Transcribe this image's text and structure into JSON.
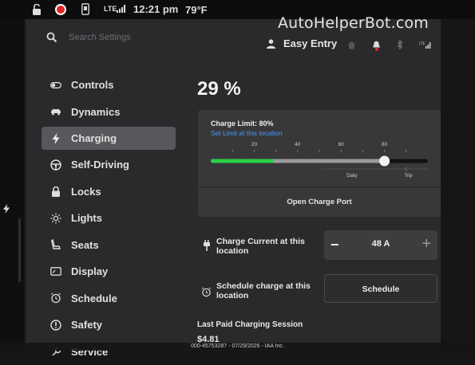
{
  "watermark": "AutoHelperBot.com",
  "status": {
    "lte": "LTE",
    "time": "12:21 pm",
    "temperature": "79°F"
  },
  "search": {
    "placeholder": "Search Settings"
  },
  "profile": {
    "name": "Easy Entry"
  },
  "top_icons": [
    "home-icon",
    "bell-icon",
    "bluetooth-icon",
    "lte-signal-icon"
  ],
  "sidebar": {
    "items": [
      {
        "label": "Controls",
        "icon": "toggle-icon",
        "active": false
      },
      {
        "label": "Dynamics",
        "icon": "car-icon",
        "active": false
      },
      {
        "label": "Charging",
        "icon": "lightning-icon",
        "active": true
      },
      {
        "label": "Self-Driving",
        "icon": "steering-wheel-icon",
        "active": false
      },
      {
        "label": "Locks",
        "icon": "lock-icon",
        "active": false
      },
      {
        "label": "Lights",
        "icon": "sun-icon",
        "active": false
      },
      {
        "label": "Seats",
        "icon": "seat-icon",
        "active": false
      },
      {
        "label": "Display",
        "icon": "display-icon",
        "active": false
      },
      {
        "label": "Schedule",
        "icon": "alarm-clock-icon",
        "active": false
      },
      {
        "label": "Safety",
        "icon": "info-icon",
        "active": false
      },
      {
        "label": "Service",
        "icon": "wrench-icon",
        "active": false
      }
    ]
  },
  "charging": {
    "battery_percent": "29 %",
    "charge_limit_label": "Charge Limit: 80%",
    "set_limit_link": "Set Limit at this location",
    "slider": {
      "ticks": [
        "20",
        "40",
        "60",
        "80"
      ],
      "tick_values": [
        20,
        40,
        60,
        80
      ],
      "current_level": 29,
      "limit_value": 80,
      "daily_label": "Daily",
      "trip_label": "Trip",
      "fill_color": "#2ad14a"
    },
    "open_port_label": "Open Charge Port",
    "current_label": "Charge Current at this location",
    "current_value": "48 A",
    "minus": "−",
    "plus": "+",
    "schedule_label": "Schedule charge at this location",
    "schedule_button": "Schedule",
    "session_title": "Last Paid Charging Session",
    "session_value": "$4.81"
  },
  "footer": "000-45753287 - 07/29/2026 - IAA Inc.",
  "colors": {
    "accent_link": "#4a9bff",
    "background": "#2a2a2c",
    "recording": "#e02525"
  }
}
